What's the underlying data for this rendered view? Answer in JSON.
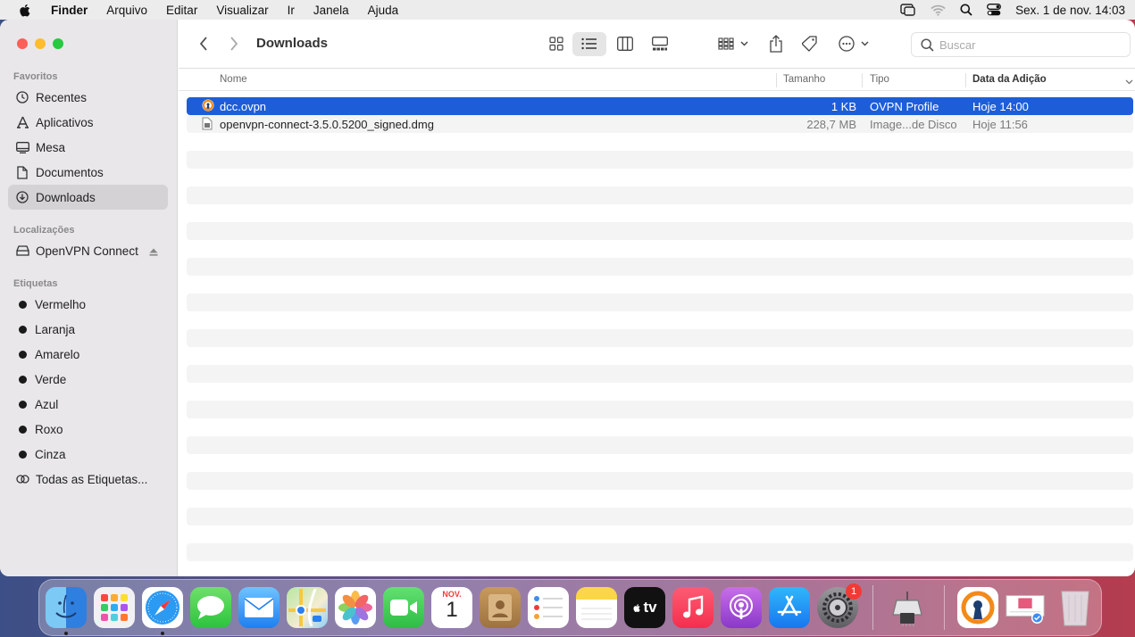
{
  "menubar": {
    "app_name": "Finder",
    "menus": [
      "Arquivo",
      "Editar",
      "Visualizar",
      "Ir",
      "Janela",
      "Ajuda"
    ],
    "clock": "Sex. 1 de nov.  14:03"
  },
  "window": {
    "title": "Downloads",
    "search_placeholder": "Buscar"
  },
  "sidebar": {
    "favorites_title": "Favoritos",
    "favorites": [
      {
        "label": "Recentes",
        "icon": "clock-icon"
      },
      {
        "label": "Aplicativos",
        "icon": "apps-icon"
      },
      {
        "label": "Mesa",
        "icon": "desktop-icon"
      },
      {
        "label": "Documentos",
        "icon": "document-icon"
      },
      {
        "label": "Downloads",
        "icon": "download-icon"
      }
    ],
    "locations_title": "Localizações",
    "locations": [
      {
        "label": "OpenVPN Connect",
        "icon": "drive-icon"
      }
    ],
    "tags_title": "Etiquetas",
    "tags": [
      "Vermelho",
      "Laranja",
      "Amarelo",
      "Verde",
      "Azul",
      "Roxo",
      "Cinza"
    ],
    "all_tags": "Todas as Etiquetas..."
  },
  "columns": {
    "name": "Nome",
    "size": "Tamanho",
    "kind": "Tipo",
    "date": "Data da Adição"
  },
  "files": [
    {
      "name": "dcc.ovpn",
      "size": "1 KB",
      "kind": "OVPN Profile",
      "date": "Hoje 14:00",
      "selected": true
    },
    {
      "name": "openvpn-connect-3.5.0.5200_signed.dmg",
      "size": "228,7 MB",
      "kind": "Image...de Disco",
      "date": "Hoje 11:56",
      "selected": false
    }
  ],
  "dock": {
    "calendar_month": "NOV.",
    "calendar_day": "1",
    "tv_label": "tv",
    "settings_badge": "1"
  },
  "colors": {
    "selection": "#1d5ed8",
    "close": "#fe5f57",
    "minimize": "#febc2e",
    "zoom": "#28c840"
  }
}
